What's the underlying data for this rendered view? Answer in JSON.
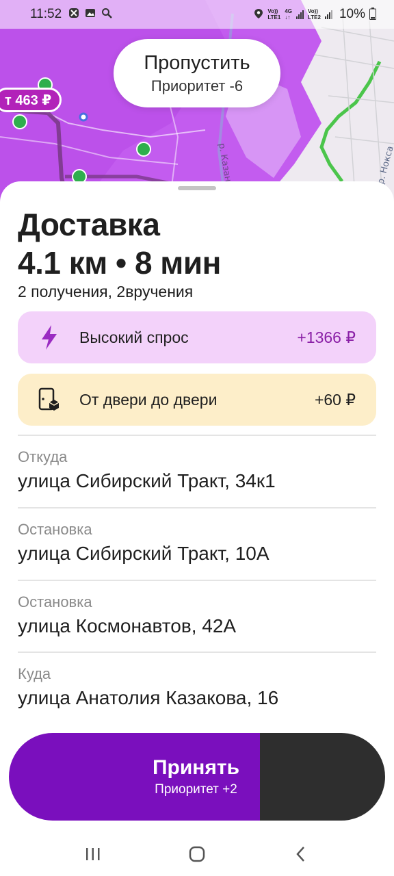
{
  "status_bar": {
    "time": "11:52",
    "battery": "10%",
    "sim1_label": "LTE1",
    "sim2_label": "LTE2",
    "net_label": "4G"
  },
  "map": {
    "price_tag": "т 463 ₽",
    "street_label_1": "р. Казанка",
    "street_label_2": "р. Нокса",
    "zone_color": "#c35cef"
  },
  "skip": {
    "title": "Пропустить",
    "subtitle": "Приоритет -6"
  },
  "order": {
    "title": "Доставка",
    "distance": "4.1 км • 8 мин",
    "subinfo": "2 получения, 2вручения"
  },
  "badges": {
    "demand": {
      "label": "Высокий спрос",
      "value": "+1366 ₽",
      "icon": "lightning-icon",
      "color": "#f3d2fa"
    },
    "door": {
      "label": "От двери до двери",
      "value": "+60 ₽",
      "icon": "door-box-icon",
      "color": "#fdeec9"
    }
  },
  "stops": [
    {
      "label": "Откуда",
      "address": "улица Сибирский Тракт, 34к1"
    },
    {
      "label": "Остановка",
      "address": "улица Сибирский Тракт, 10А"
    },
    {
      "label": "Остановка",
      "address": "улица Космонавтов, 42А"
    },
    {
      "label": "Куда",
      "address": "улица Анатолия Казакова, 16"
    }
  ],
  "accept": {
    "title": "Принять",
    "subtitle": "Приоритет +2",
    "color": "#7a0fbd"
  },
  "navbar": {
    "recent": "recent-apps-icon",
    "home": "home-icon",
    "back": "back-icon"
  }
}
